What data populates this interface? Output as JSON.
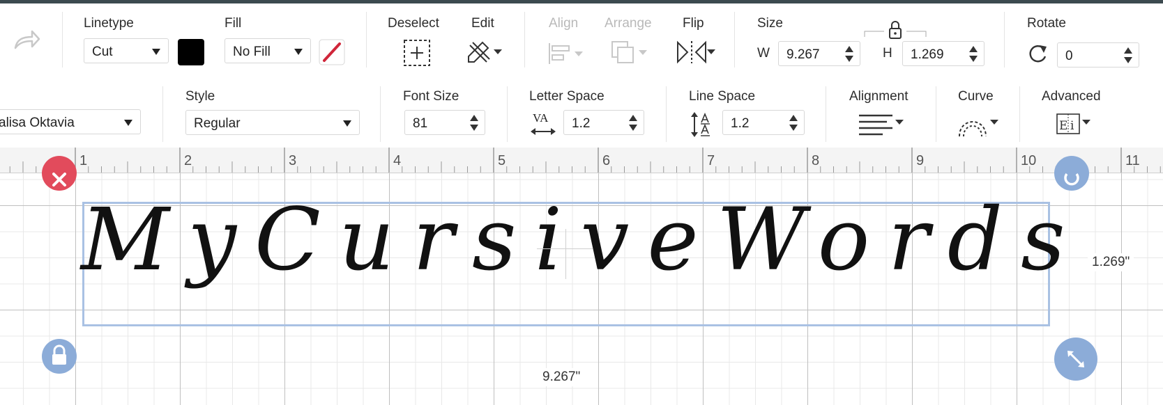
{
  "toolbar": {
    "linetype": {
      "label": "Linetype",
      "value": "Cut"
    },
    "fill": {
      "label": "Fill",
      "value": "No Fill"
    },
    "deselect_label": "Deselect",
    "edit_label": "Edit",
    "align_label": "Align",
    "arrange_label": "Arrange",
    "flip_label": "Flip",
    "size": {
      "label": "Size",
      "w_label": "W",
      "w_value": "9.267",
      "h_label": "H",
      "h_value": "1.269"
    },
    "rotate": {
      "label": "Rotate",
      "value": "0"
    }
  },
  "text_toolbar": {
    "font": {
      "value": "alisa Oktavia"
    },
    "style": {
      "label": "Style",
      "value": "Regular"
    },
    "font_size": {
      "label": "Font Size",
      "value": "81"
    },
    "letter_space": {
      "label": "Letter Space",
      "icon_text": "VA",
      "value": "1.2"
    },
    "line_space": {
      "label": "Line Space",
      "value": "1.2"
    },
    "alignment_label": "Alignment",
    "curve_label": "Curve",
    "advanced_label": "Advanced"
  },
  "ruler": {
    "marks": [
      "1",
      "2",
      "3",
      "4",
      "5",
      "6",
      "7",
      "8",
      "9",
      "10",
      "11"
    ]
  },
  "canvas": {
    "text": "MyCursiveWords",
    "width_dim": "9.267\"",
    "height_dim": "1.269\""
  },
  "colors": {
    "selection": "#a9c1e3",
    "delete": "#e24b5c",
    "handle_blue": "#8cacd8",
    "swatch": "#000000",
    "top_bar": "#3c4a4f"
  },
  "icons": [
    "redo-icon",
    "deselect-icon",
    "edit-icon",
    "align-icon",
    "arrange-icon",
    "flip-icon",
    "lock-icon",
    "rotate-icon",
    "letter-space-icon",
    "line-space-icon",
    "alignment-icon",
    "curve-icon",
    "advanced-icon",
    "delete-icon",
    "rotate-handle-icon",
    "lock-handle-icon",
    "resize-handle-icon"
  ]
}
